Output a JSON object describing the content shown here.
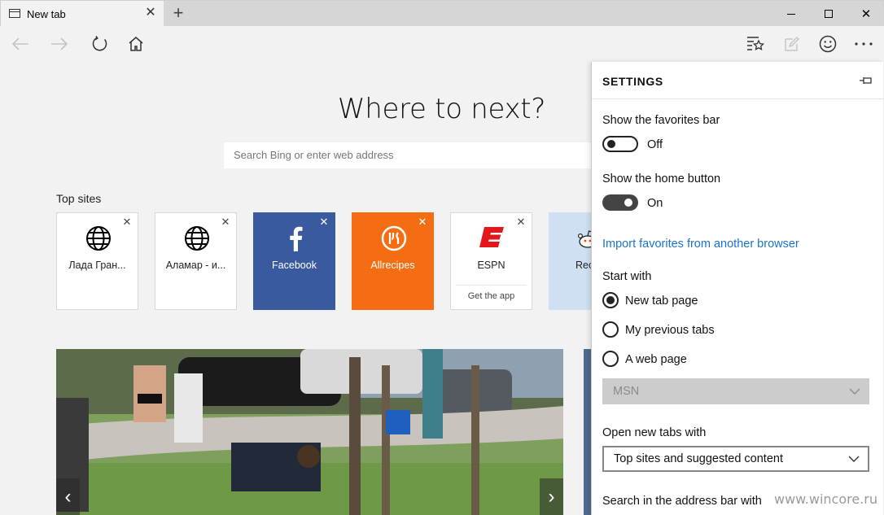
{
  "window": {
    "tab_title": "New tab",
    "tab_close": "✕",
    "new_tab": "+",
    "close_glyph": "✕"
  },
  "toolbar": {
    "icons": [
      "back-icon",
      "forward-icon",
      "refresh-icon",
      "home-icon",
      "hub-icon",
      "web-note-icon",
      "feedback-icon",
      "more-icon"
    ]
  },
  "new_tab_page": {
    "heading": "Where to next?",
    "search_placeholder": "Search Bing or enter web address",
    "top_sites_label": "Top sites",
    "tiles": [
      {
        "label": "Лада Гран...",
        "icon": "globe-icon",
        "close": "✕"
      },
      {
        "label": "Аламар - и...",
        "icon": "globe-icon",
        "close": "✕"
      },
      {
        "label": "Facebook",
        "icon": "facebook-icon",
        "close": "✕",
        "color": "#3a5aa0"
      },
      {
        "label": "Allrecipes",
        "icon": "allrecipes-icon",
        "close": "✕",
        "color": "#f46d12"
      },
      {
        "label": "ESPN",
        "sub": "Get the app",
        "icon": "espn-icon",
        "close": "✕"
      },
      {
        "label": "Rec",
        "icon": "reddit-icon"
      }
    ],
    "photo_prev": "‹",
    "photo_next": "›"
  },
  "settings": {
    "title": "SETTINGS",
    "favorites_bar_label": "Show the favorites bar",
    "favorites_bar_state": "Off",
    "home_button_label": "Show the home button",
    "home_button_state": "On",
    "import_link": "Import favorites from another browser",
    "start_with_label": "Start with",
    "start_options": [
      "New tab page",
      "My previous tabs",
      "A web page"
    ],
    "start_selected": "New tab page",
    "web_page_select": "MSN",
    "open_new_tabs_label": "Open new tabs with",
    "open_new_tabs_value": "Top sites and suggested content",
    "search_label": "Search in the address bar with"
  },
  "watermark": "www.wincore.ru",
  "colors": {
    "accent_link": "#1b73c9",
    "facebook": "#3a5aa0",
    "allrecipes": "#f46d12",
    "espn": "#e3161b"
  }
}
